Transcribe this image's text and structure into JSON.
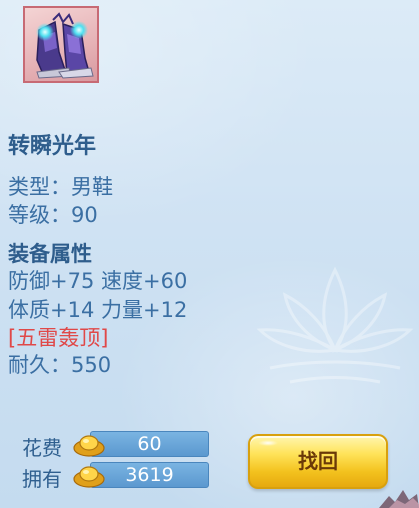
{
  "item": {
    "name": "转瞬光年",
    "type_line": "类型：男鞋",
    "level_line": "等级：90",
    "section_title": "装备属性",
    "attr_line_1": "防御+75 速度+60",
    "attr_line_2": "体质+14 力量+12",
    "special": "[五雷轰顶]",
    "durability_line": "耐久：550",
    "icon": "boots-icon"
  },
  "purchase": {
    "cost_label": "花费",
    "cost_value": "60",
    "owned_label": "拥有",
    "owned_value": "3619",
    "currency_icon": "gold-ingot-icon"
  },
  "actions": {
    "find_back_label": "找回"
  },
  "colors": {
    "text_blue": "#3b6fa3",
    "special_red": "#e04848",
    "button_gold": "#f3c21e",
    "bar_blue": "#5b98cf"
  }
}
